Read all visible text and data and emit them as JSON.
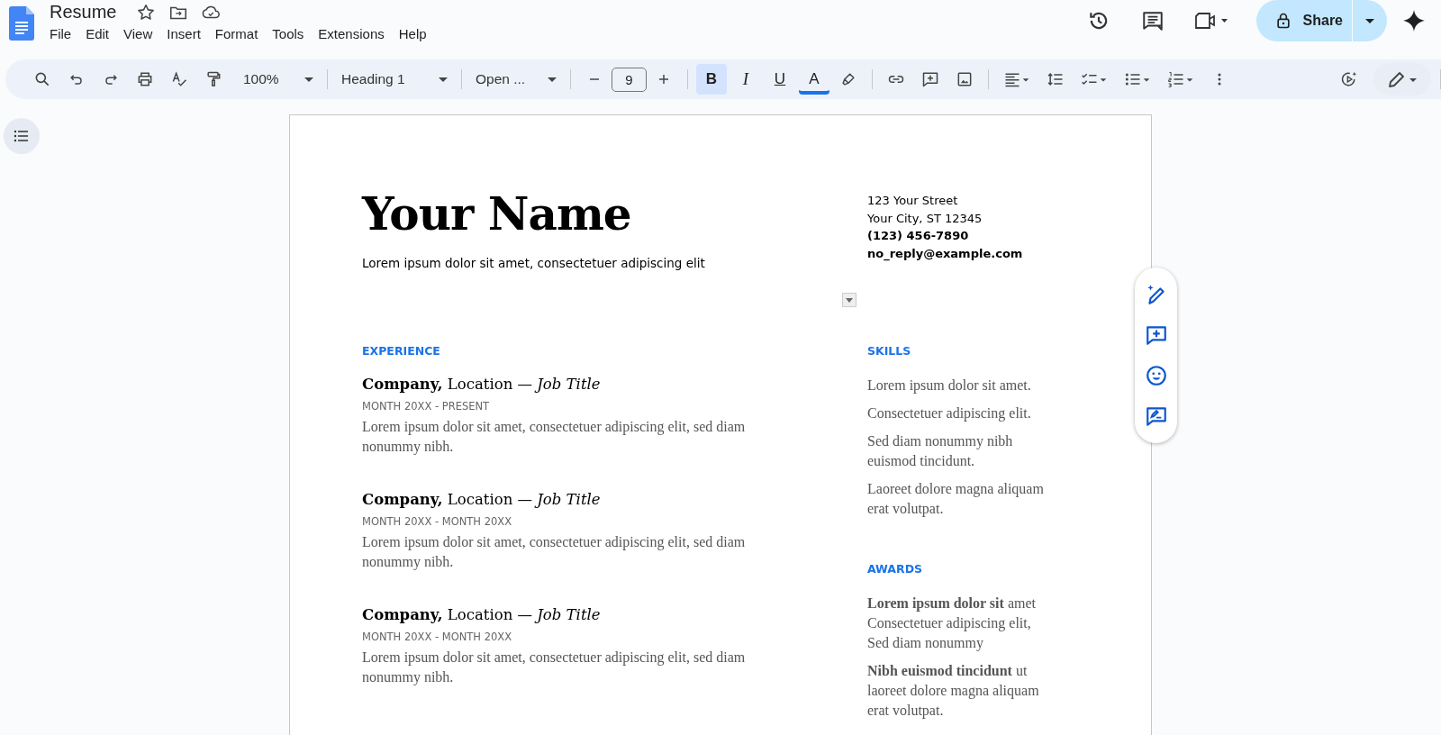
{
  "document_title": "Resume",
  "menu": [
    "File",
    "Edit",
    "View",
    "Insert",
    "Format",
    "Tools",
    "Extensions",
    "Help"
  ],
  "share": {
    "label": "Share"
  },
  "toolbar": {
    "zoom": "100%",
    "style": "Heading 1",
    "font": "Open ...",
    "font_size": "9",
    "format": [
      {
        "kind": "bold",
        "label": "B",
        "selected": true
      },
      {
        "kind": "italic",
        "label": "I",
        "selected": false
      },
      {
        "kind": "underline",
        "label": "U",
        "selected": false
      },
      {
        "kind": "color",
        "label": "A",
        "selected": false
      }
    ]
  },
  "document": {
    "name": "Your Name",
    "tagline": "Lorem ipsum dolor sit amet, consectetuer adipiscing elit",
    "contact": [
      {
        "text": "123 Your Street",
        "bold": false
      },
      {
        "text": "Your City, ST 12345",
        "bold": false
      },
      {
        "text": "(123) 456-7890",
        "bold": true
      },
      {
        "text": "no_reply@example.com",
        "bold": true
      }
    ],
    "experience": {
      "heading": "EXPERIENCE",
      "jobs": [
        {
          "title": "**Company,** Location — *Job Title*",
          "dates": "MONTH 20XX - PRESENT",
          "description": "Lorem ipsum dolor sit amet, consectetuer adipiscing elit, sed diam nonummy nibh."
        },
        {
          "title": "**Company,** Location — *Job Title*",
          "dates": "MONTH 20XX - MONTH 20XX",
          "description": "Lorem ipsum dolor sit amet, consectetuer adipiscing elit, sed diam nonummy nibh."
        },
        {
          "title": "**Company,** Location — *Job Title*",
          "dates": "MONTH 20XX - MONTH 20XX",
          "description": "Lorem ipsum dolor sit amet, consectetuer adipiscing elit, sed diam nonummy nibh."
        }
      ]
    },
    "skills": {
      "heading": "SKILLS",
      "items": [
        "Lorem ipsum dolor sit amet.",
        "Consectetuer adipiscing elit.",
        "Sed diam nonummy nibh euismod tincidunt.",
        "Laoreet dolore magna aliquam erat volutpat."
      ]
    },
    "awards": {
      "heading": "AWARDS",
      "items": [
        "**Lorem ipsum dolor sit** amet Consectetuer adipiscing elit, Sed diam nonummy",
        "**Nibh euismod tincidunt** ut laoreet dolore magna aliquam erat volutpat."
      ]
    }
  }
}
